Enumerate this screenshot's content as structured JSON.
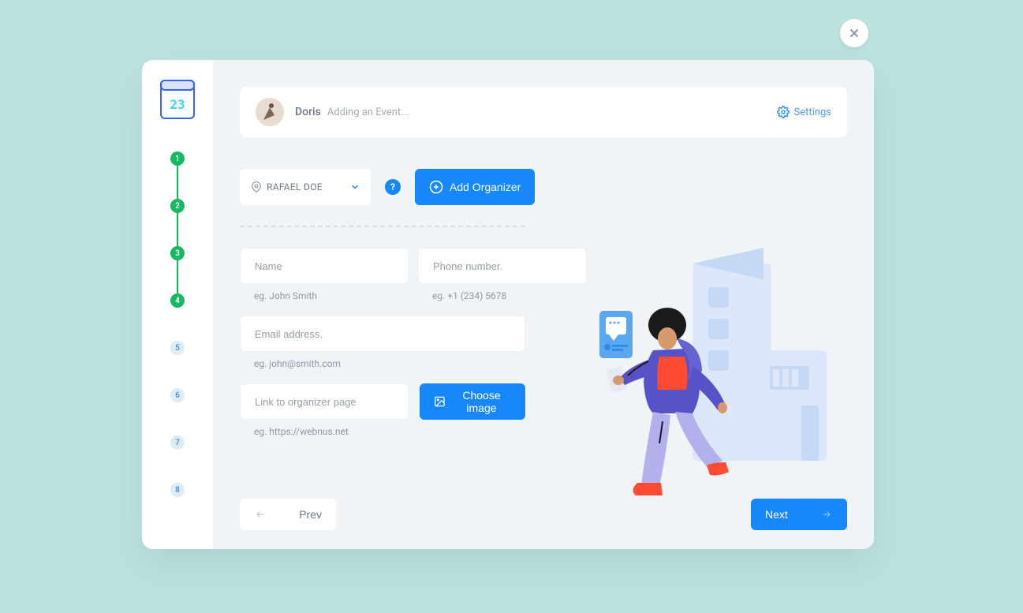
{
  "header": {
    "username": "Doris",
    "action": "Adding an Event...",
    "settings_label": "Settings"
  },
  "steps": [
    {
      "num": "1",
      "state": "done"
    },
    {
      "num": "2",
      "state": "done"
    },
    {
      "num": "3",
      "state": "done"
    },
    {
      "num": "4",
      "state": "done"
    },
    {
      "num": "5",
      "state": "pending"
    },
    {
      "num": "6",
      "state": "pending"
    },
    {
      "num": "7",
      "state": "pending"
    },
    {
      "num": "8",
      "state": "pending"
    }
  ],
  "organizer_select": "RAFAEL DOE",
  "help": "?",
  "add_organizer_label": "Add Organizer",
  "form": {
    "name_placeholder": "Name",
    "name_hint": "eg. John Smith",
    "phone_placeholder": "Phone number.",
    "phone_hint": "eg. +1 (234) 5678",
    "email_placeholder": "Email address.",
    "email_hint": "eg. john@smith.com",
    "link_placeholder": "Link to organizer page",
    "link_hint": "eg. https://webnus.net",
    "choose_image_label": "Choose image"
  },
  "footer": {
    "prev": "Prev",
    "next": "Next"
  }
}
